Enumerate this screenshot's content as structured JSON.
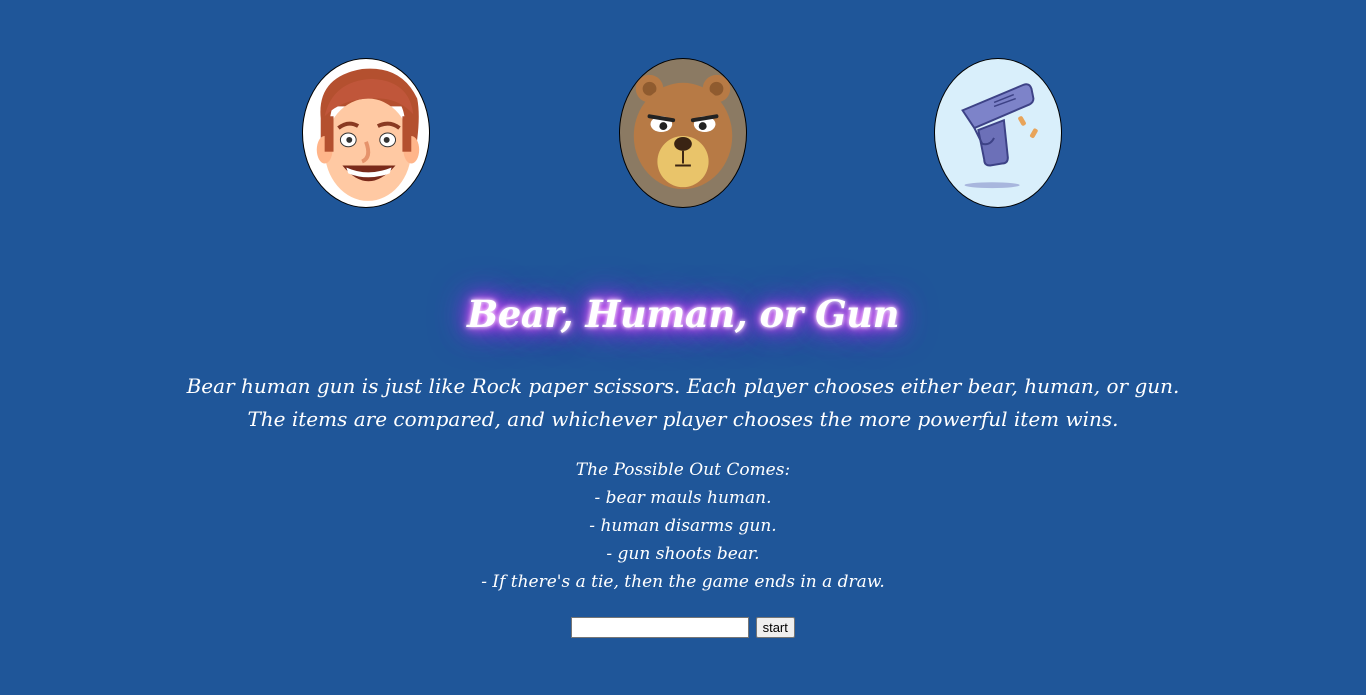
{
  "images": {
    "human": {
      "icon": "human-face-icon",
      "bg": "#ffffff"
    },
    "bear": {
      "icon": "bear-face-icon",
      "bg": "#8b7a63"
    },
    "gun": {
      "icon": "pistol-icon",
      "bg": "#d9effb"
    }
  },
  "title": "Bear, Human, or Gun",
  "description": {
    "line1": "Bear human gun is just like Rock paper scissors. Each player chooses either bear, human, or gun.",
    "line2": "The items are compared, and whichever player chooses the more powerful item wins."
  },
  "outcomes": {
    "heading": "The Possible Out Comes:",
    "items": [
      "- bear mauls human.",
      "- human disarms gun.",
      "- gun shoots bear.",
      "- If there's a tie, then the game ends in a draw."
    ]
  },
  "controls": {
    "input_value": "",
    "input_placeholder": "",
    "start_label": "start"
  },
  "colors": {
    "background": "#1f5699",
    "text": "#ffffff",
    "glow": "#cc33ff"
  }
}
